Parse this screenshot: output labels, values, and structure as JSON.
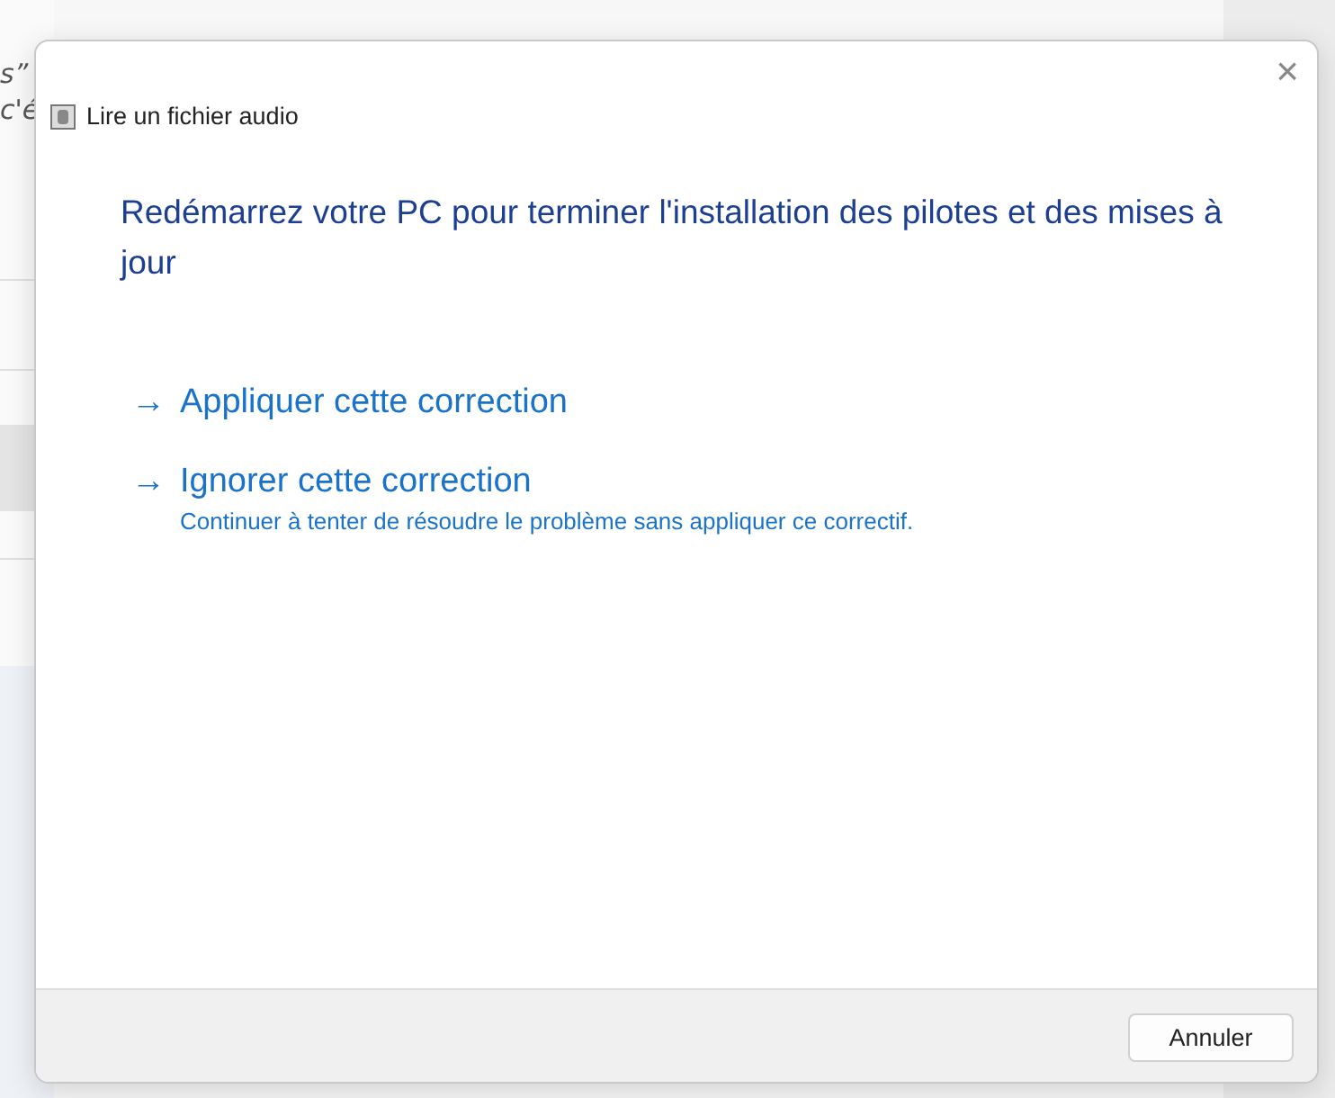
{
  "background_window": {
    "text_fragments": [
      "s”",
      "c'é"
    ]
  },
  "dialog": {
    "title": "Lire un fichier audio",
    "close": "×",
    "heading": "Redémarrez votre PC pour terminer l'installation des pilotes et des mises à jour",
    "options": [
      {
        "arrow": "→",
        "label": "Appliquer cette correction"
      },
      {
        "arrow": "→",
        "label": "Ignorer cette correction",
        "description": "Continuer à tenter de résoudre le problème sans appliquer ce correctif."
      }
    ],
    "buttons": [
      "Annuler"
    ]
  }
}
